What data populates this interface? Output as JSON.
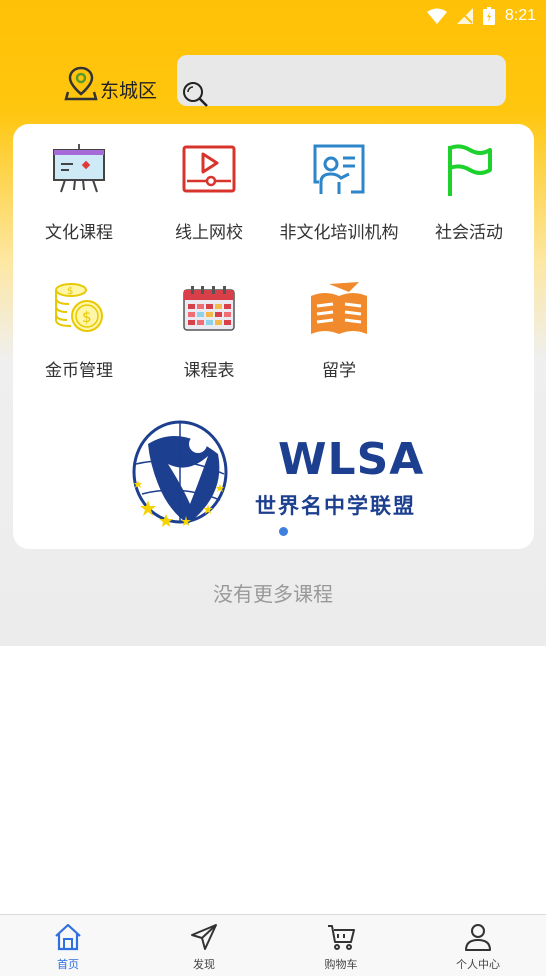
{
  "status_bar": {
    "time": "8:21"
  },
  "header": {
    "location": "东城区",
    "search_placeholder": ""
  },
  "categories": [
    {
      "label": "文化课程",
      "icon": "presentation-board-icon"
    },
    {
      "label": "线上网校",
      "icon": "video-screen-icon"
    },
    {
      "label": "非文化培训机构",
      "icon": "teacher-board-icon"
    },
    {
      "label": "社会活动",
      "icon": "flag-icon"
    },
    {
      "label": "金币管理",
      "icon": "coins-icon"
    },
    {
      "label": "课程表",
      "icon": "calendar-icon"
    },
    {
      "label": "留学",
      "icon": "book-plane-icon"
    }
  ],
  "banner": {
    "title": "WLSA",
    "subtitle": "世界名中学联盟"
  },
  "footer_text": "没有更多课程",
  "tabs": [
    {
      "label": "首页",
      "icon": "home-icon",
      "active": true
    },
    {
      "label": "发现",
      "icon": "paper-plane-icon",
      "active": false
    },
    {
      "label": "购物车",
      "icon": "cart-icon",
      "active": false
    },
    {
      "label": "个人中心",
      "icon": "person-icon",
      "active": false
    }
  ],
  "colors": {
    "header_yellow": "#ffc107",
    "active_tab": "#2f6fe0",
    "brand_blue": "#1d3f8f"
  }
}
